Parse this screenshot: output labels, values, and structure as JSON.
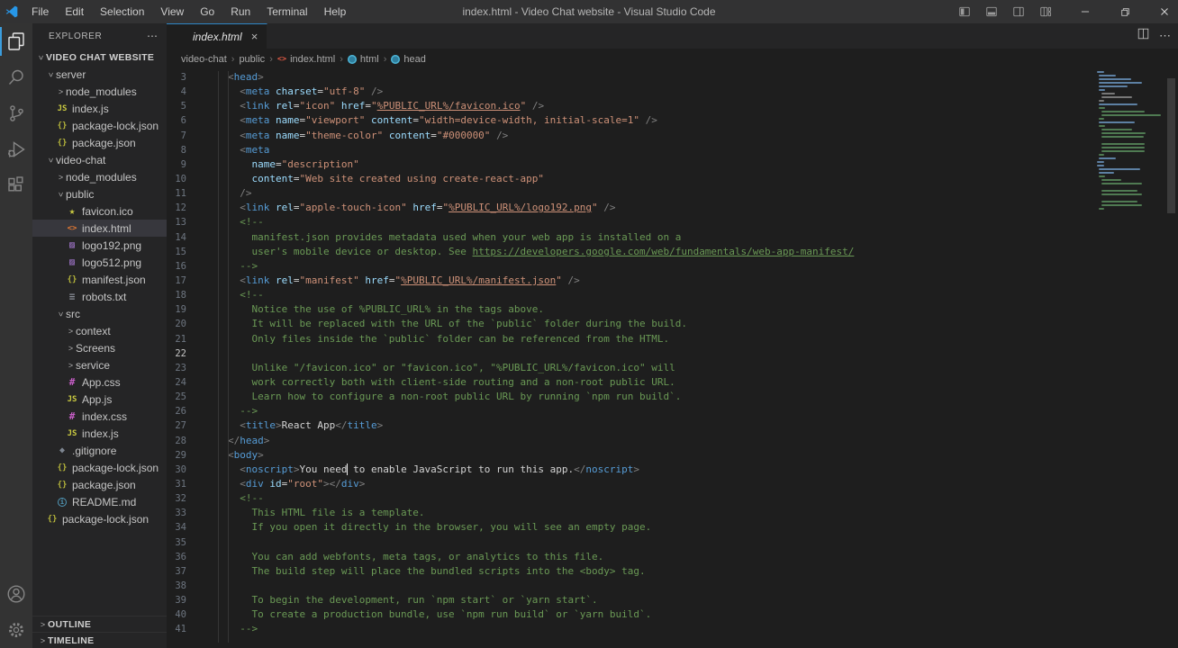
{
  "colors": {
    "accent": "#2f86c6",
    "editor_bg": "#1e1e1e",
    "sidebar_bg": "#252526",
    "activitybar_bg": "#333333",
    "titlebar_bg": "#323233",
    "selection_bg": "#37373d"
  },
  "title_bar": {
    "title": "index.html - Video Chat website - Visual Studio Code",
    "menus": [
      "File",
      "Edit",
      "Selection",
      "View",
      "Go",
      "Run",
      "Terminal",
      "Help"
    ],
    "window_controls": [
      "layout-sidebar-left",
      "layout-panel",
      "layout-sidebar-right",
      "customize-layout",
      "minimize",
      "restore",
      "close"
    ]
  },
  "activity_bar": {
    "items": [
      "explorer",
      "search",
      "source-control",
      "run-and-debug",
      "extensions"
    ],
    "bottom_items": [
      "account",
      "settings"
    ]
  },
  "sidebar": {
    "header": "EXPLORER",
    "items": [
      {
        "label": "VIDEO CHAT WEBSITE",
        "indent": 0,
        "chevron": "open",
        "section": true
      },
      {
        "label": "server",
        "indent": 1,
        "chevron": "open"
      },
      {
        "label": "node_modules",
        "indent": 2,
        "chevron": "closed"
      },
      {
        "label": "index.js",
        "indent": 2,
        "icon": "js"
      },
      {
        "label": "package-lock.json",
        "indent": 2,
        "icon": "json"
      },
      {
        "label": "package.json",
        "indent": 2,
        "icon": "json"
      },
      {
        "label": "video-chat",
        "indent": 1,
        "chevron": "open"
      },
      {
        "label": "node_modules",
        "indent": 2,
        "chevron": "closed"
      },
      {
        "label": "public",
        "indent": 2,
        "chevron": "open"
      },
      {
        "label": "favicon.ico",
        "indent": 3,
        "icon": "star"
      },
      {
        "label": "index.html",
        "indent": 3,
        "icon": "html",
        "selected": true
      },
      {
        "label": "logo192.png",
        "indent": 3,
        "icon": "img"
      },
      {
        "label": "logo512.png",
        "indent": 3,
        "icon": "img"
      },
      {
        "label": "manifest.json",
        "indent": 3,
        "icon": "json"
      },
      {
        "label": "robots.txt",
        "indent": 3,
        "icon": "txt"
      },
      {
        "label": "src",
        "indent": 2,
        "chevron": "open"
      },
      {
        "label": "context",
        "indent": 3,
        "chevron": "closed"
      },
      {
        "label": "Screens",
        "indent": 3,
        "chevron": "closed"
      },
      {
        "label": "service",
        "indent": 3,
        "chevron": "closed"
      },
      {
        "label": "App.css",
        "indent": 3,
        "icon": "css"
      },
      {
        "label": "App.js",
        "indent": 3,
        "icon": "js"
      },
      {
        "label": "index.css",
        "indent": 3,
        "icon": "css"
      },
      {
        "label": "index.js",
        "indent": 3,
        "icon": "js"
      },
      {
        "label": ".gitignore",
        "indent": 2,
        "icon": "git"
      },
      {
        "label": "package-lock.json",
        "indent": 2,
        "icon": "json"
      },
      {
        "label": "package.json",
        "indent": 2,
        "icon": "json"
      },
      {
        "label": "README.md",
        "indent": 2,
        "icon": "info"
      },
      {
        "label": "package-lock.json",
        "indent": 1,
        "icon": "json"
      }
    ],
    "bottom_sections": [
      "OUTLINE",
      "TIMELINE"
    ]
  },
  "editor": {
    "tab": {
      "label": "index.html",
      "icon": "html"
    },
    "tab_actions": [
      "split-editor",
      "more-actions"
    ],
    "breadcrumb": {
      "items": [
        {
          "label": "video-chat"
        },
        {
          "label": "public"
        },
        {
          "label": "index.html",
          "icon": "html"
        },
        {
          "label": "html",
          "icon": "symbol"
        },
        {
          "label": "head",
          "icon": "symbol"
        }
      ]
    },
    "code": {
      "lines": [
        {
          "n": 3,
          "segs": [
            [
              "p",
              "<"
            ],
            [
              "t",
              "head"
            ],
            [
              "p",
              ">"
            ]
          ]
        },
        {
          "n": 4,
          "segs": [
            [
              "x",
              "  "
            ],
            [
              "p",
              "<"
            ],
            [
              "t",
              "meta"
            ],
            [
              "x",
              " "
            ],
            [
              "a",
              "charset"
            ],
            [
              "x",
              "="
            ],
            [
              "s",
              "\"utf-8\""
            ],
            [
              "x",
              " "
            ],
            [
              "p",
              "/>"
            ]
          ]
        },
        {
          "n": 5,
          "segs": [
            [
              "x",
              "  "
            ],
            [
              "p",
              "<"
            ],
            [
              "t",
              "link"
            ],
            [
              "x",
              " "
            ],
            [
              "a",
              "rel"
            ],
            [
              "x",
              "="
            ],
            [
              "s",
              "\"icon\""
            ],
            [
              "x",
              " "
            ],
            [
              "a",
              "href"
            ],
            [
              "x",
              "="
            ],
            [
              "s",
              "\""
            ],
            [
              "sl",
              "%PUBLIC_URL%/favicon.ico"
            ],
            [
              "s",
              "\""
            ],
            [
              "x",
              " "
            ],
            [
              "p",
              "/>"
            ]
          ]
        },
        {
          "n": 6,
          "segs": [
            [
              "x",
              "  "
            ],
            [
              "p",
              "<"
            ],
            [
              "t",
              "meta"
            ],
            [
              "x",
              " "
            ],
            [
              "a",
              "name"
            ],
            [
              "x",
              "="
            ],
            [
              "s",
              "\"viewport\""
            ],
            [
              "x",
              " "
            ],
            [
              "a",
              "content"
            ],
            [
              "x",
              "="
            ],
            [
              "s",
              "\"width=device-width, initial-scale=1\""
            ],
            [
              "x",
              " "
            ],
            [
              "p",
              "/>"
            ]
          ]
        },
        {
          "n": 7,
          "segs": [
            [
              "x",
              "  "
            ],
            [
              "p",
              "<"
            ],
            [
              "t",
              "meta"
            ],
            [
              "x",
              " "
            ],
            [
              "a",
              "name"
            ],
            [
              "x",
              "="
            ],
            [
              "s",
              "\"theme-color\""
            ],
            [
              "x",
              " "
            ],
            [
              "a",
              "content"
            ],
            [
              "x",
              "="
            ],
            [
              "s",
              "\"#000000\""
            ],
            [
              "x",
              " "
            ],
            [
              "p",
              "/>"
            ]
          ]
        },
        {
          "n": 8,
          "segs": [
            [
              "x",
              "  "
            ],
            [
              "p",
              "<"
            ],
            [
              "t",
              "meta"
            ]
          ]
        },
        {
          "n": 9,
          "segs": [
            [
              "x",
              "    "
            ],
            [
              "a",
              "name"
            ],
            [
              "x",
              "="
            ],
            [
              "s",
              "\"description\""
            ]
          ]
        },
        {
          "n": 10,
          "segs": [
            [
              "x",
              "    "
            ],
            [
              "a",
              "content"
            ],
            [
              "x",
              "="
            ],
            [
              "s",
              "\"Web site created using create-react-app\""
            ]
          ]
        },
        {
          "n": 11,
          "segs": [
            [
              "x",
              "  "
            ],
            [
              "p",
              "/>"
            ]
          ]
        },
        {
          "n": 12,
          "segs": [
            [
              "x",
              "  "
            ],
            [
              "p",
              "<"
            ],
            [
              "t",
              "link"
            ],
            [
              "x",
              " "
            ],
            [
              "a",
              "rel"
            ],
            [
              "x",
              "="
            ],
            [
              "s",
              "\"apple-touch-icon\""
            ],
            [
              "x",
              " "
            ],
            [
              "a",
              "href"
            ],
            [
              "x",
              "="
            ],
            [
              "s",
              "\""
            ],
            [
              "sl",
              "%PUBLIC_URL%/logo192.png"
            ],
            [
              "s",
              "\""
            ],
            [
              "x",
              " "
            ],
            [
              "p",
              "/>"
            ]
          ]
        },
        {
          "n": 13,
          "segs": [
            [
              "x",
              "  "
            ],
            [
              "c",
              "<!--"
            ]
          ]
        },
        {
          "n": 14,
          "segs": [
            [
              "c",
              "    manifest.json provides metadata used when your web app is installed on a"
            ]
          ]
        },
        {
          "n": 15,
          "segs": [
            [
              "c",
              "    user's mobile device or desktop. See "
            ],
            [
              "cl",
              "https://developers.google.com/web/fundamentals/web-app-manifest/"
            ]
          ]
        },
        {
          "n": 16,
          "segs": [
            [
              "c",
              "  -->"
            ]
          ]
        },
        {
          "n": 17,
          "segs": [
            [
              "x",
              "  "
            ],
            [
              "p",
              "<"
            ],
            [
              "t",
              "link"
            ],
            [
              "x",
              " "
            ],
            [
              "a",
              "rel"
            ],
            [
              "x",
              "="
            ],
            [
              "s",
              "\"manifest\""
            ],
            [
              "x",
              " "
            ],
            [
              "a",
              "href"
            ],
            [
              "x",
              "="
            ],
            [
              "s",
              "\""
            ],
            [
              "sl",
              "%PUBLIC_URL%/manifest.json"
            ],
            [
              "s",
              "\""
            ],
            [
              "x",
              " "
            ],
            [
              "p",
              "/>"
            ]
          ]
        },
        {
          "n": 18,
          "segs": [
            [
              "x",
              "  "
            ],
            [
              "c",
              "<!--"
            ]
          ]
        },
        {
          "n": 19,
          "segs": [
            [
              "c",
              "    Notice the use of %PUBLIC_URL% in the tags above."
            ]
          ]
        },
        {
          "n": 20,
          "segs": [
            [
              "c",
              "    It will be replaced with the URL of the `public` folder during the build."
            ]
          ]
        },
        {
          "n": 21,
          "segs": [
            [
              "c",
              "    Only files inside the `public` folder can be referenced from the HTML."
            ]
          ]
        },
        {
          "n": 22,
          "active": true,
          "segs": []
        },
        {
          "n": 23,
          "segs": [
            [
              "c",
              "    Unlike \"/favicon.ico\" or \"favicon.ico\", \"%PUBLIC_URL%/favicon.ico\" will"
            ]
          ]
        },
        {
          "n": 24,
          "segs": [
            [
              "c",
              "    work correctly both with client-side routing and a non-root public URL."
            ]
          ]
        },
        {
          "n": 25,
          "segs": [
            [
              "c",
              "    Learn how to configure a non-root public URL by running `npm run build`."
            ]
          ]
        },
        {
          "n": 26,
          "segs": [
            [
              "c",
              "  -->"
            ]
          ]
        },
        {
          "n": 27,
          "segs": [
            [
              "x",
              "  "
            ],
            [
              "p",
              "<"
            ],
            [
              "t",
              "title"
            ],
            [
              "p",
              ">"
            ],
            [
              "x",
              "React App"
            ],
            [
              "p",
              "</"
            ],
            [
              "t",
              "title"
            ],
            [
              "p",
              ">"
            ]
          ]
        },
        {
          "n": 28,
          "segs": [
            [
              "p",
              "</"
            ],
            [
              "t",
              "head"
            ],
            [
              "p",
              ">"
            ]
          ]
        },
        {
          "n": 29,
          "segs": [
            [
              "p",
              "<"
            ],
            [
              "t",
              "body"
            ],
            [
              "p",
              ">"
            ]
          ]
        },
        {
          "n": 30,
          "segs": [
            [
              "x",
              "  "
            ],
            [
              "p",
              "<"
            ],
            [
              "t",
              "noscript"
            ],
            [
              "p",
              ">"
            ],
            [
              "x",
              "You need"
            ],
            [
              "caret",
              ""
            ],
            [
              "x",
              " to enable JavaScript to run this app."
            ],
            [
              "p",
              "</"
            ],
            [
              "t",
              "noscript"
            ],
            [
              "p",
              ">"
            ]
          ]
        },
        {
          "n": 31,
          "segs": [
            [
              "x",
              "  "
            ],
            [
              "p",
              "<"
            ],
            [
              "t",
              "div"
            ],
            [
              "x",
              " "
            ],
            [
              "a",
              "id"
            ],
            [
              "x",
              "="
            ],
            [
              "s",
              "\"root\""
            ],
            [
              "p",
              "></"
            ],
            [
              "t",
              "div"
            ],
            [
              "p",
              ">"
            ]
          ]
        },
        {
          "n": 32,
          "segs": [
            [
              "x",
              "  "
            ],
            [
              "c",
              "<!--"
            ]
          ]
        },
        {
          "n": 33,
          "segs": [
            [
              "c",
              "    This HTML file is a template."
            ]
          ]
        },
        {
          "n": 34,
          "segs": [
            [
              "c",
              "    If you open it directly in the browser, you will see an empty page."
            ]
          ]
        },
        {
          "n": 35,
          "segs": []
        },
        {
          "n": 36,
          "segs": [
            [
              "c",
              "    You can add webfonts, meta tags, or analytics to this file."
            ]
          ]
        },
        {
          "n": 37,
          "segs": [
            [
              "c",
              "    The build step will place the bundled scripts into the <body> tag."
            ]
          ]
        },
        {
          "n": 38,
          "segs": []
        },
        {
          "n": 39,
          "segs": [
            [
              "c",
              "    To begin the development, run `npm start` or `yarn start`."
            ]
          ]
        },
        {
          "n": 40,
          "segs": [
            [
              "c",
              "    To create a production bundle, use `npm run build` or `yarn build`."
            ]
          ]
        },
        {
          "n": 41,
          "segs": [
            [
              "c",
              "  -->"
            ]
          ]
        }
      ]
    }
  }
}
